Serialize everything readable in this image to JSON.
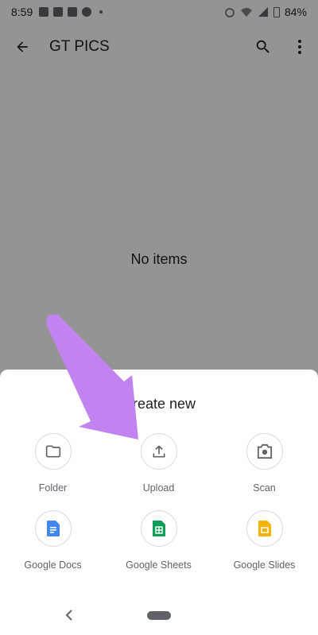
{
  "status_bar": {
    "time": "8:59",
    "battery": "84%"
  },
  "app_bar": {
    "title": "GT PICS"
  },
  "main": {
    "empty_text": "No items"
  },
  "sheet": {
    "title": "Create new",
    "items": [
      {
        "label": "Folder",
        "icon": "folder-icon"
      },
      {
        "label": "Upload",
        "icon": "upload-icon"
      },
      {
        "label": "Scan",
        "icon": "camera-icon"
      },
      {
        "label": "Google Docs",
        "icon": "google-docs-icon"
      },
      {
        "label": "Google Sheets",
        "icon": "google-sheets-icon"
      },
      {
        "label": "Google Slides",
        "icon": "google-slides-icon"
      }
    ]
  },
  "colors": {
    "docs_blue": "#4285f4",
    "sheets_green": "#0f9d58",
    "slides_yellow": "#f4b400",
    "arrow_purple": "#c183f0"
  }
}
